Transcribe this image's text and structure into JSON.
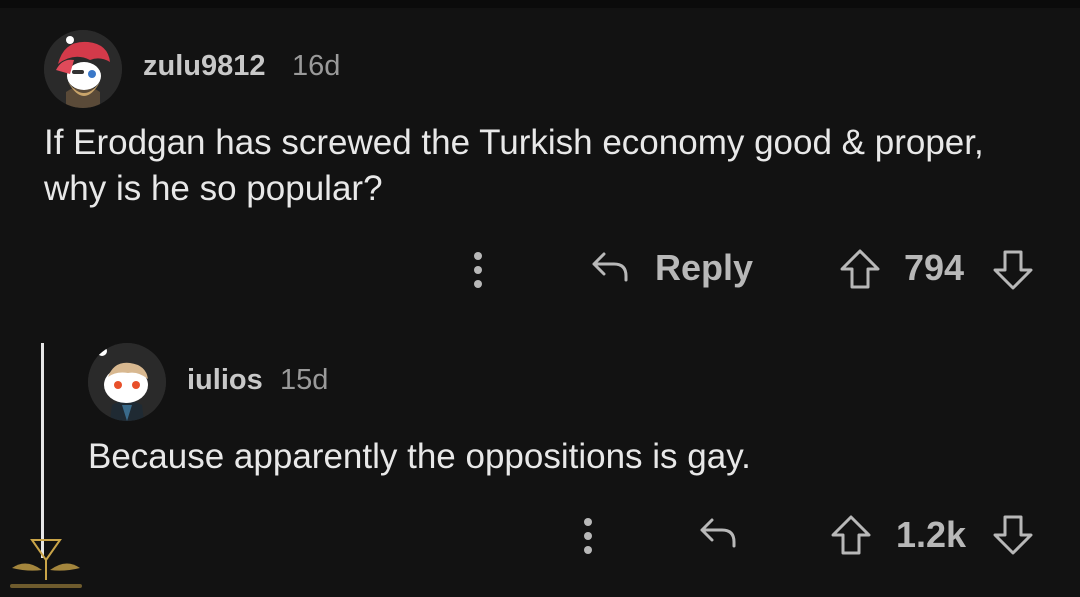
{
  "comments": [
    {
      "username": "zulu9812",
      "age": "16d",
      "body": "If Erodgan has screwed the Turkish economy good & proper, why is he so popular?",
      "reply_label": "Reply",
      "score": "794"
    },
    {
      "username": "iulios",
      "age": "15d",
      "body": "Because apparently the oppositions is gay.",
      "score": "1.2k"
    }
  ],
  "icons": {
    "more": "more-options-icon",
    "reply": "reply-arrow-icon",
    "upvote": "upvote-arrow-icon",
    "downvote": "downvote-arrow-icon"
  },
  "colors": {
    "background": "#121212",
    "text": "#e8e8e8",
    "muted": "#9a9a9a",
    "action": "#b8b8b8",
    "thread_line": "#e6e6e6"
  }
}
